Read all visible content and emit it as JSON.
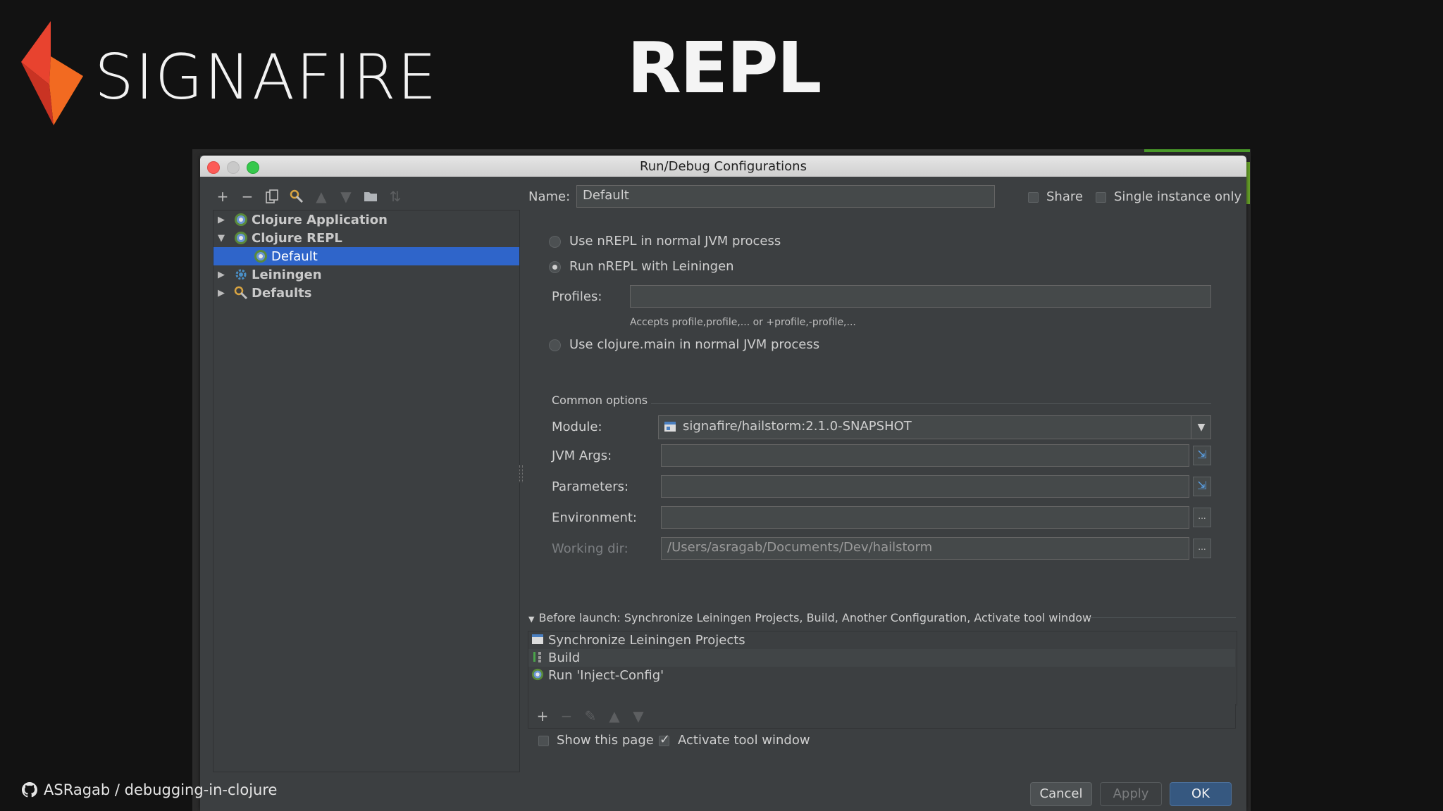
{
  "slide": {
    "brand": "SIGNAFIRE",
    "title": "REPL",
    "footer": "ASRagab / debugging-in-clojure"
  },
  "colors": {
    "brand_red": "#e8432f",
    "brand_orange": "#f26a21",
    "selection": "#2f65ca",
    "ok_button": "#365880"
  },
  "dialog": {
    "title": "Run/Debug Configurations",
    "toolbar": [
      "add-icon",
      "remove-icon",
      "copy-icon",
      "wrench-icon",
      "move-up-icon",
      "move-down-icon",
      "folder-icon",
      "sort-icon"
    ],
    "tree": {
      "clojure_application": "Clojure Application",
      "clojure_repl": "Clojure REPL",
      "default": "Default",
      "leiningen": "Leiningen",
      "defaults": "Defaults"
    },
    "name_label": "Name:",
    "name_value": "Default",
    "share_label": "Share",
    "single_instance_label": "Single instance only",
    "share_checked": false,
    "single_instance_checked": false,
    "mode": {
      "opt_nrepl_jvm": "Use nREPL in normal JVM process",
      "opt_nrepl_lein": "Run nREPL with Leiningen",
      "opt_clojure_main": "Use clojure.main in normal JVM process",
      "selected": "opt_nrepl_lein"
    },
    "profiles_label": "Profiles:",
    "profiles_value": "",
    "profiles_hint": "Accepts profile,profile,... or +profile,-profile,...",
    "common_options": "Common options",
    "module_label": "Module:",
    "module_value": "signafire/hailstorm:2.1.0-SNAPSHOT",
    "jvm_args_label": "JVM Args:",
    "jvm_args_value": "",
    "parameters_label": "Parameters:",
    "parameters_value": "",
    "environment_label": "Environment:",
    "environment_value": "",
    "working_dir_label": "Working dir:",
    "working_dir_value": "/Users/asragab/Documents/Dev/hailstorm",
    "ellipsis": "...",
    "before_launch": {
      "header": "Before launch: Synchronize Leiningen Projects, Build, Another Configuration, Activate tool window",
      "items": [
        "Synchronize Leiningen Projects",
        "Build",
        "Run 'Inject-Config'"
      ]
    },
    "show_this_page_label": "Show this page",
    "show_this_page_checked": false,
    "activate_tool_window_label": "Activate tool window",
    "activate_tool_window_checked": true,
    "buttons": {
      "cancel": "Cancel",
      "apply": "Apply",
      "ok": "OK"
    }
  }
}
